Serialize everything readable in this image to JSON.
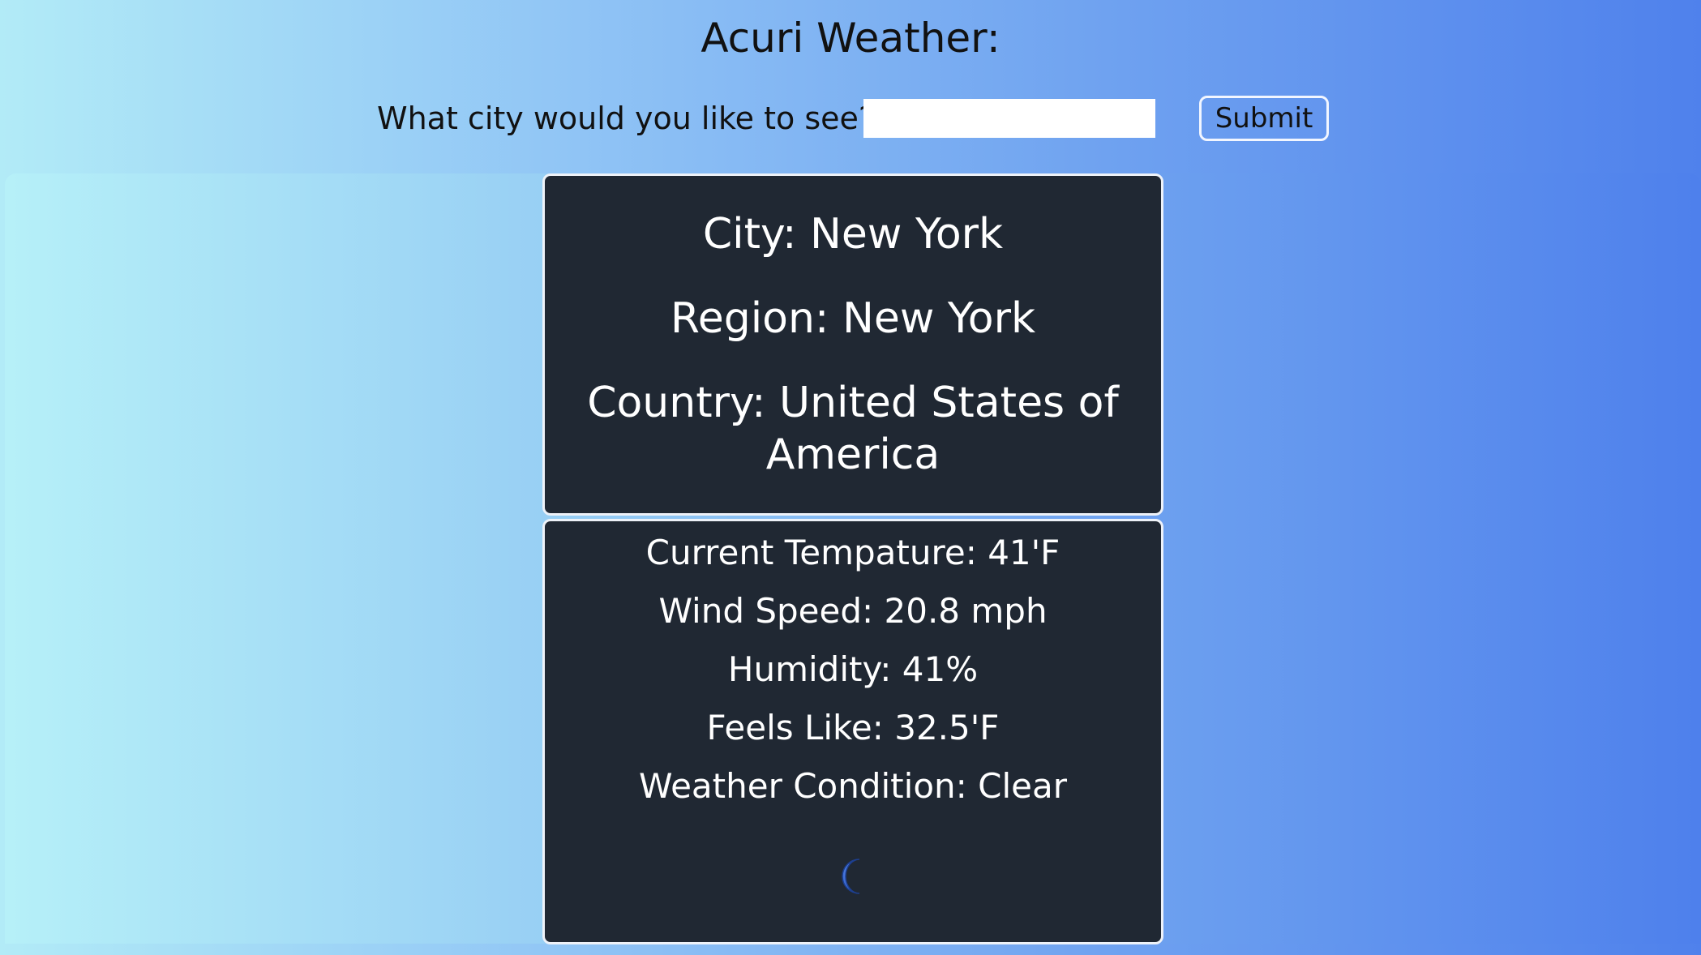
{
  "header": {
    "title": "Acuri Weather:",
    "prompt": "What city would you like to see?",
    "input_value": "",
    "submit_label": "Submit"
  },
  "location": {
    "city": "City: New York",
    "region": "Region: New York",
    "country": "Country: United States of America"
  },
  "weather": {
    "temperature": "Current Tempature: 41'F",
    "wind_speed": "Wind Speed: 20.8 mph",
    "humidity": "Humidity: 41%",
    "feels_like": "Feels Like: 32.5'F",
    "condition": "Weather Condition: Clear",
    "condition_icon": "moon-icon"
  },
  "colors": {
    "card_background": "#202833",
    "card_border": "#eef2f8",
    "gradient_left": "#b2ebf7",
    "gradient_right": "#4f81ec",
    "moon_color": "#3a6fd8"
  }
}
